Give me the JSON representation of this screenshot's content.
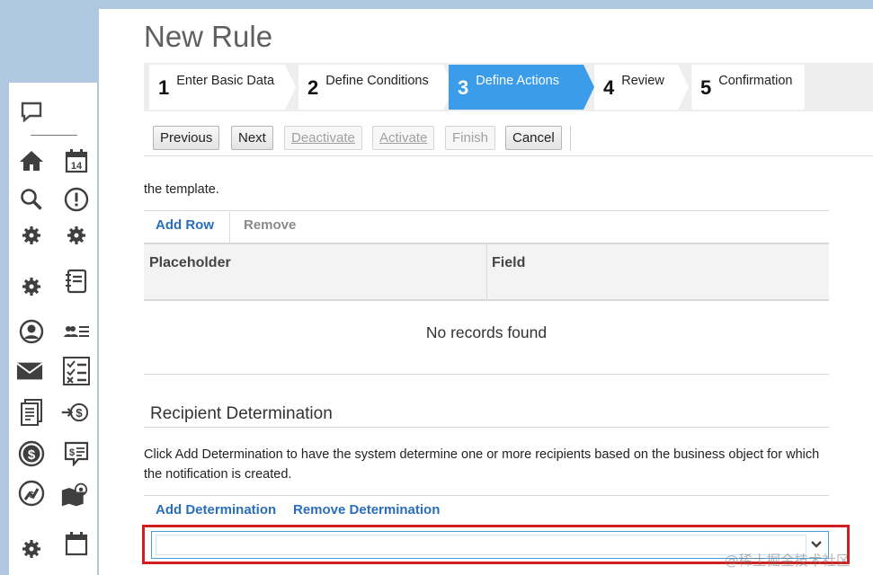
{
  "page": {
    "title": "New Rule"
  },
  "wizard": {
    "steps": [
      {
        "number": "1",
        "label": "Enter Basic Data"
      },
      {
        "number": "2",
        "label": "Define Conditions"
      },
      {
        "number": "3",
        "label": "Define Actions"
      },
      {
        "number": "4",
        "label": "Review"
      },
      {
        "number": "5",
        "label": "Confirmation"
      }
    ],
    "active_step": 3
  },
  "toolbar": {
    "previous": "Previous",
    "next": "Next",
    "deactivate": "Deactivate",
    "activate": "Activate",
    "finish": "Finish",
    "cancel": "Cancel"
  },
  "placeholders": {
    "intro_text": "the template.",
    "add_row": "Add Row",
    "remove": "Remove",
    "columns": [
      "Placeholder",
      "Field"
    ],
    "empty_text": "No records found"
  },
  "recipient": {
    "title": "Recipient Determination",
    "description": "Click Add Determination to have the system determine one or more recipients based on the business object for which the notification is created.",
    "add_determination": "Add Determination",
    "remove_determination": "Remove Determination",
    "select_value": ""
  },
  "sidebar": {
    "icons": [
      "comment-icon",
      "home-icon",
      "calendar-icon",
      "search-icon",
      "alert-icon",
      "gear-icon",
      "gear-icon",
      "gear-icon",
      "notebook-icon",
      "user-icon",
      "contacts-icon",
      "mail-icon",
      "checklist-icon",
      "document-icon",
      "payment-icon",
      "dollar-icon",
      "invoice-icon",
      "chart-icon",
      "map-icon",
      "gear-icon",
      "calendar-icon"
    ],
    "calendar_day": "14"
  },
  "watermark": "@稀土掘金技术社区",
  "colors": {
    "accent": "#3b9cea",
    "link": "#2a6ebb",
    "highlight": "#d11f1f"
  }
}
